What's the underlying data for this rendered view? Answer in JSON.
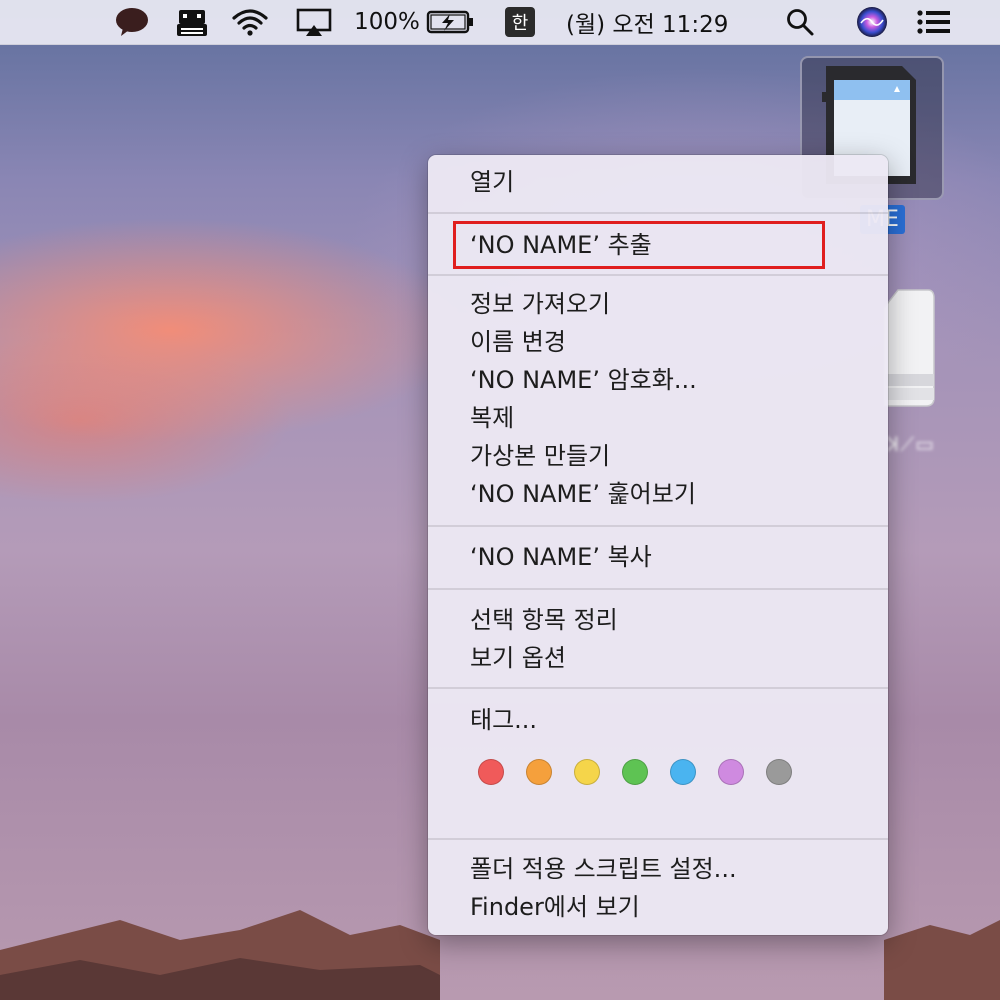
{
  "menubar": {
    "battery_percent": "100%",
    "input_method": "한",
    "datetime": "(월) 오전 11:29"
  },
  "desktop": {
    "drive_label_visible": "ME",
    "blurred_label": "ꓘ⟋▭"
  },
  "context_menu": {
    "open": "열기",
    "eject": "‘NO NAME’ 추출",
    "get_info": "정보 가져오기",
    "rename": "이름 변경",
    "encrypt": "‘NO NAME’ 암호화...",
    "duplicate": "복제",
    "make_alias": "가상본 만들기",
    "quick_look": "‘NO NAME’ 훑어보기",
    "copy": "‘NO NAME’ 복사",
    "clean_up": "선택 항목 정리",
    "view_options": "보기 옵션",
    "tags": "태그...",
    "tag_colors": [
      "#f05a5a",
      "#f5a03c",
      "#f5d54a",
      "#5ec353",
      "#4ab4f0",
      "#cf8ae0",
      "#9a9a9a"
    ],
    "folder_actions": "폴더 적용 스크립트 설정...",
    "show_in_finder": "Finder에서 보기"
  },
  "colors": {
    "highlight_border": "#e01e1e",
    "selection_blue": "#2a6fd6"
  }
}
